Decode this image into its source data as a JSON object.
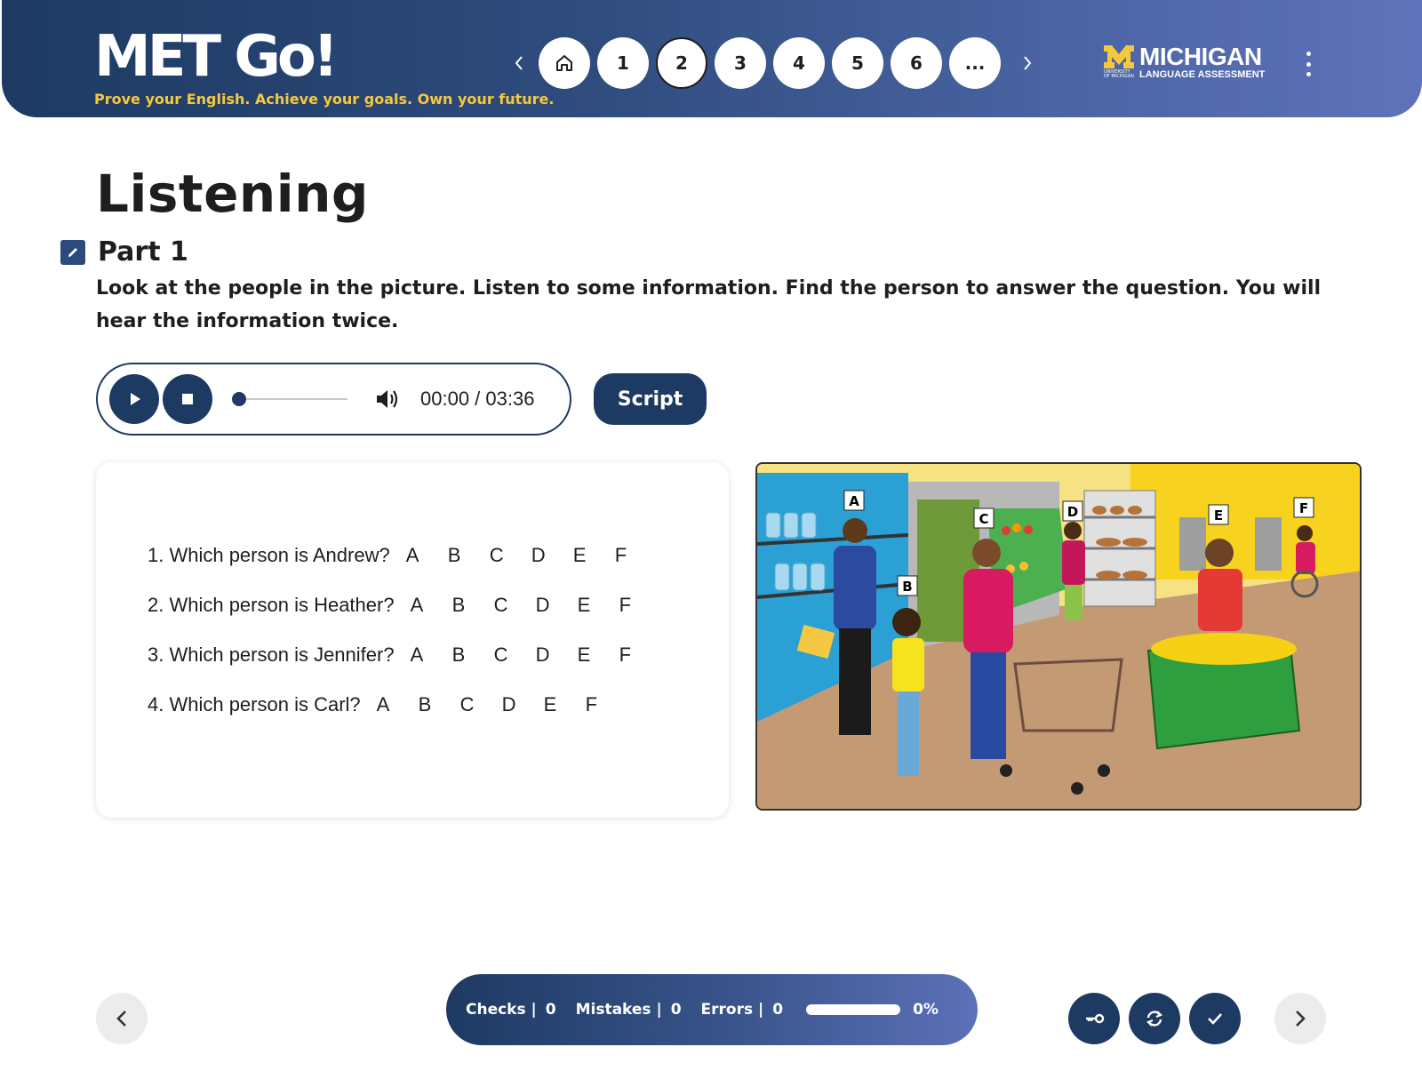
{
  "header": {
    "brand_title": "MET Go!",
    "tagline": "Prove your English. Achieve your goals. Own your future.",
    "pages": [
      "1",
      "2",
      "3",
      "4",
      "5",
      "6",
      "..."
    ],
    "active_page": "2",
    "logo_name": "MICHIGAN",
    "logo_sub": "LANGUAGE ASSESSMENT",
    "logo_tiny": "UNIVERSITY OF MICHIGAN"
  },
  "main": {
    "title": "Listening",
    "part_title": "Part 1",
    "instructions": "Look at the people in the picture. Listen to some information. Find the person to answer the question. You will hear the information twice."
  },
  "player": {
    "time": "00:00 / 03:36",
    "progress": 0,
    "script_label": "Script"
  },
  "questions": [
    {
      "text": "1. Which person is Andrew?",
      "options": [
        "A",
        "B",
        "C",
        "D",
        "E",
        "F"
      ]
    },
    {
      "text": "2. Which person is Heather?",
      "options": [
        "A",
        "B",
        "C",
        "D",
        "E",
        "F"
      ]
    },
    {
      "text": "3. Which person is Jennifer?",
      "options": [
        "A",
        "B",
        "C",
        "D",
        "E",
        "F"
      ]
    },
    {
      "text": "4. Which person is Carl?",
      "options": [
        "A",
        "B",
        "C",
        "D",
        "E",
        "F"
      ]
    }
  ],
  "picture": {
    "labels": [
      "A",
      "B",
      "C",
      "D",
      "E",
      "F"
    ],
    "description_icon": "supermarket-scene-image"
  },
  "footer": {
    "checks_label": "Checks |",
    "checks_value": "0",
    "mistakes_label": "Mistakes |",
    "mistakes_value": "0",
    "errors_label": "Errors |",
    "errors_value": "0",
    "progress_percent": "0%"
  },
  "colors": {
    "navy": "#1d3a63",
    "gradient_end": "#5f73ba",
    "tagline_yellow": "#f6c93c"
  }
}
